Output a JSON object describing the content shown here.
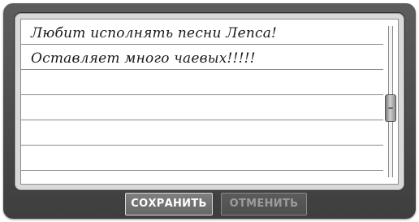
{
  "note": {
    "lines": [
      "Любит исполнять песни Лепса!",
      "Оставляет много чаевых!!!!!",
      "",
      "",
      "",
      ""
    ]
  },
  "scrollbar": {
    "thumb_position": 0.55
  },
  "buttons": {
    "save_label": "СОХРАНИТЬ",
    "cancel_label": "ОТМЕНИТЬ",
    "cancel_enabled": false
  },
  "colors": {
    "panel": "#4a4a4a",
    "paper": "#ffffff",
    "rule_line": "#8a8a8a",
    "save_text": "#ffffff",
    "cancel_text_disabled": "#9c9c9c"
  }
}
